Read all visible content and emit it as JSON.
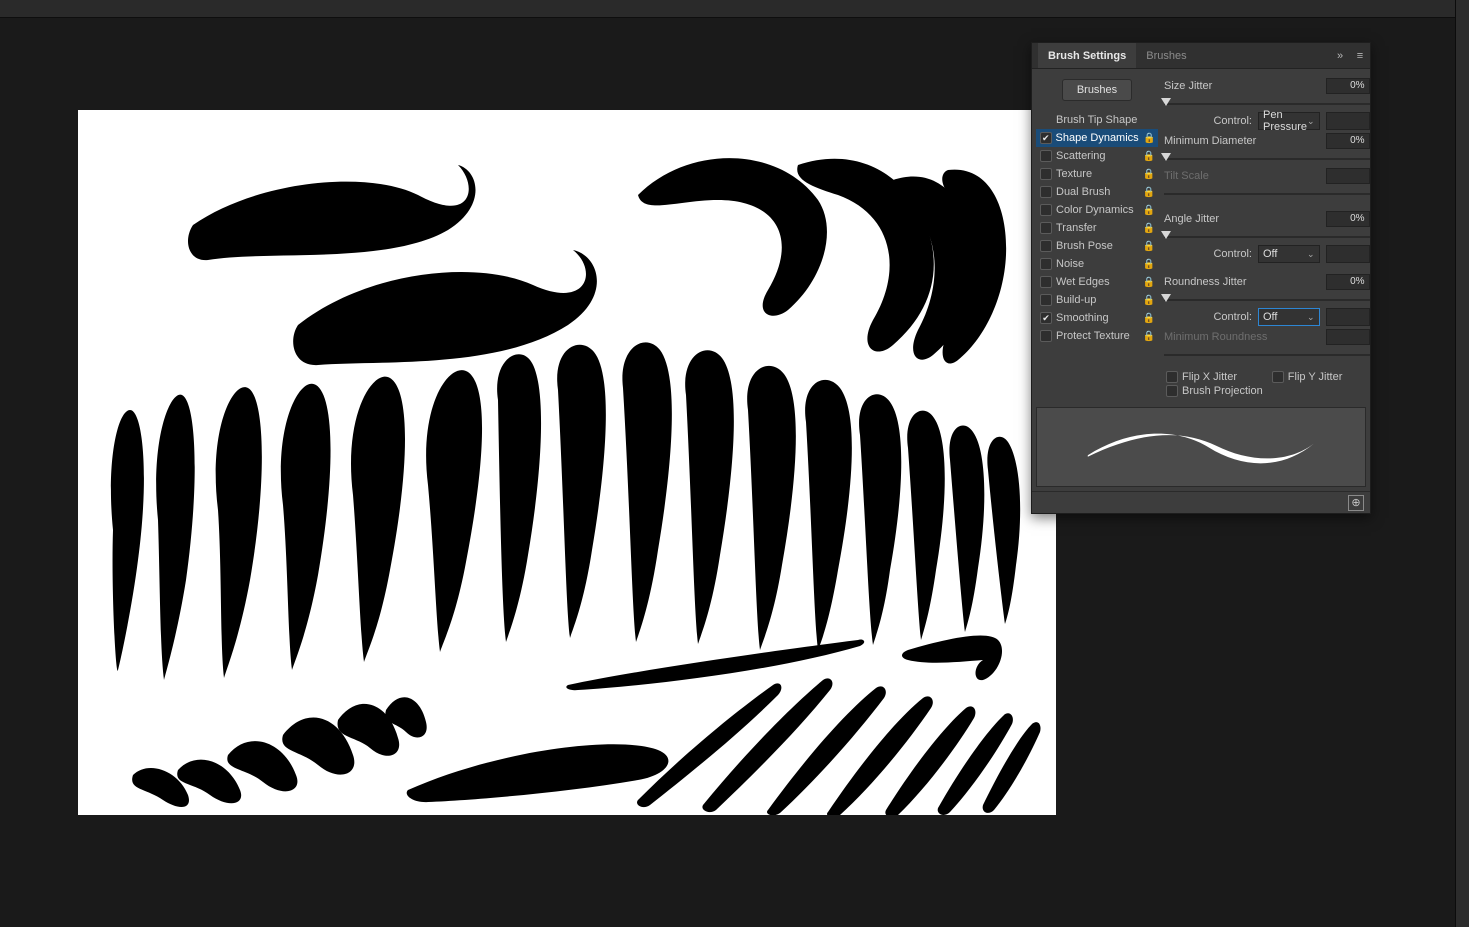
{
  "panel": {
    "tabs": {
      "brush_settings": "Brush Settings",
      "brushes": "Brushes"
    },
    "brushes_button": "Brushes",
    "categories": [
      {
        "label": "Brush Tip Shape",
        "checkbox": null,
        "lock": false,
        "selected": false
      },
      {
        "label": "Shape Dynamics",
        "checkbox": true,
        "lock": true,
        "selected": true
      },
      {
        "label": "Scattering",
        "checkbox": false,
        "lock": true,
        "selected": false
      },
      {
        "label": "Texture",
        "checkbox": false,
        "lock": true,
        "selected": false
      },
      {
        "label": "Dual Brush",
        "checkbox": false,
        "lock": true,
        "selected": false
      },
      {
        "label": "Color Dynamics",
        "checkbox": false,
        "lock": true,
        "selected": false
      },
      {
        "label": "Transfer",
        "checkbox": false,
        "lock": true,
        "selected": false
      },
      {
        "label": "Brush Pose",
        "checkbox": false,
        "lock": true,
        "selected": false
      },
      {
        "label": "Noise",
        "checkbox": false,
        "lock": true,
        "selected": false
      },
      {
        "label": "Wet Edges",
        "checkbox": false,
        "lock": true,
        "selected": false
      },
      {
        "label": "Build-up",
        "checkbox": false,
        "lock": true,
        "selected": false
      },
      {
        "label": "Smoothing",
        "checkbox": true,
        "lock": true,
        "selected": false
      },
      {
        "label": "Protect Texture",
        "checkbox": false,
        "lock": true,
        "selected": false
      }
    ],
    "params": {
      "size_jitter_label": "Size Jitter",
      "size_jitter_value": "0%",
      "control_label": "Control:",
      "size_control_value": "Pen Pressure",
      "min_diameter_label": "Minimum Diameter",
      "min_diameter_value": "0%",
      "tilt_scale_label": "Tilt Scale",
      "angle_jitter_label": "Angle Jitter",
      "angle_jitter_value": "0%",
      "angle_control_value": "Off",
      "roundness_jitter_label": "Roundness Jitter",
      "roundness_jitter_value": "0%",
      "roundness_control_value": "Off",
      "min_roundness_label": "Minimum Roundness",
      "flip_x_label": "Flip X Jitter",
      "flip_y_label": "Flip Y Jitter",
      "brush_projection_label": "Brush Projection"
    }
  },
  "glyphs": {
    "lock": "🔒",
    "menu": "≡",
    "collapse": "»",
    "chev": "⌄",
    "new": "⊕"
  }
}
